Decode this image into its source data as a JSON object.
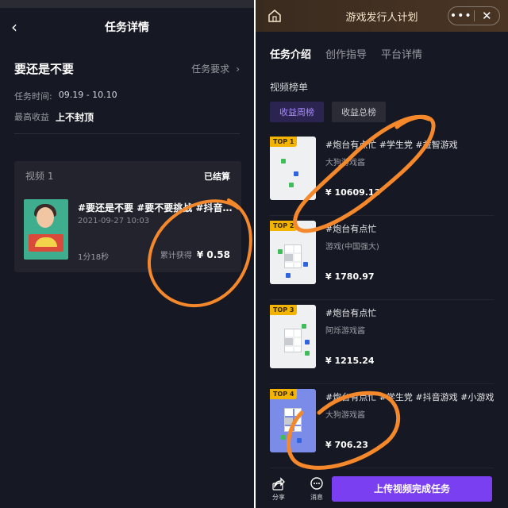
{
  "left": {
    "title": "任务详情",
    "task_name": "要还是不要",
    "requirements_label": "任务要求",
    "task_time_label": "任务时间:",
    "task_time_value": "09.19 - 10.10",
    "max_earnings_label": "最高收益",
    "max_earnings_value": "上不封顶",
    "card": {
      "label": "视频 1",
      "status": "已结算",
      "video_title": "#要还是不要 #要不要挑战 #抖音...",
      "date": "2021-09-27 10:03",
      "duration": "1分18秒",
      "earned_label": "累计获得",
      "earned_value": "¥ 0.58"
    }
  },
  "right": {
    "title": "游戏发行人计划",
    "tabs": [
      "任务介绍",
      "创作指导",
      "平台详情"
    ],
    "section_title": "视频榜单",
    "pills": [
      "收益周榜",
      "收益总榜"
    ],
    "items": [
      {
        "badge": "TOP 1",
        "title": "#炮台有点忙 #学生党 #益智游戏",
        "author": "大狗游戏酱",
        "amount": "¥ 10609.13"
      },
      {
        "badge": "TOP 2",
        "title": "#炮台有点忙",
        "author": "游戏(中国强大)",
        "amount": "¥ 1780.97"
      },
      {
        "badge": "TOP 3",
        "title": "#炮台有点忙",
        "author": "阿烁游戏酱",
        "amount": "¥ 1215.24"
      },
      {
        "badge": "TOP 4",
        "title": "#炮台有点忙 #学生党 #抖音游戏 #小游戏",
        "author": "大狗游戏酱",
        "amount": "¥ 706.23"
      }
    ],
    "bottom": {
      "share_label": "分享",
      "message_label": "消息",
      "cta_label": "上传视频完成任务"
    }
  }
}
